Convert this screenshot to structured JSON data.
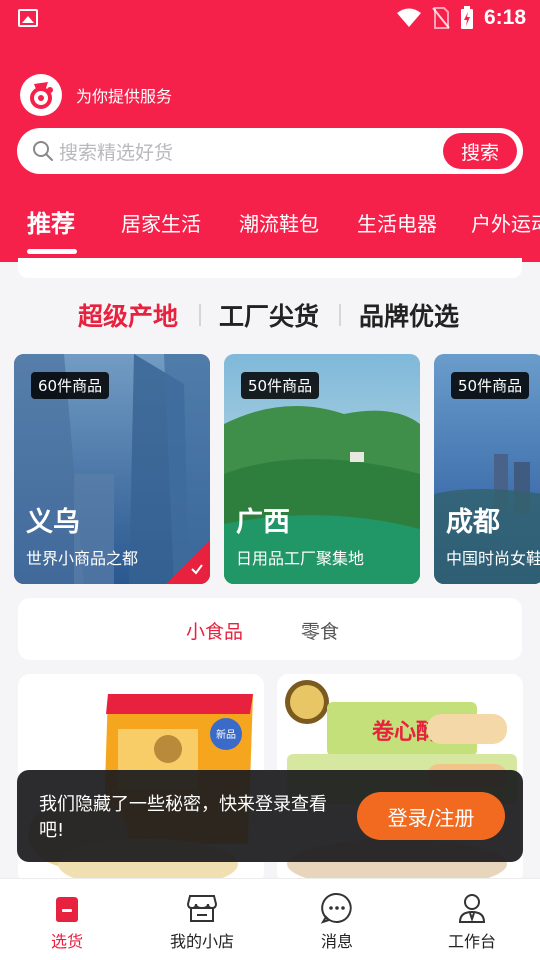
{
  "status_bar": {
    "time": "6:18"
  },
  "brand": {
    "tagline": "为你提供服务"
  },
  "search": {
    "placeholder": "搜索精选好货",
    "button_label": "搜索"
  },
  "category_tabs": [
    "推荐",
    "居家生活",
    "潮流鞋包",
    "生活电器",
    "户外运动"
  ],
  "active_category": "推荐",
  "section_tabs": [
    "超级产地",
    "工厂尖货",
    "品牌优选"
  ],
  "active_section": "超级产地",
  "regions": [
    {
      "count": "60件商品",
      "name": "义乌",
      "desc": "世界小商品之都",
      "selected": true
    },
    {
      "count": "50件商品",
      "name": "广西",
      "desc": "日用品工厂聚集地",
      "selected": false
    },
    {
      "count": "50件商品",
      "name": "成都",
      "desc": "中国时尚女鞋",
      "selected": false
    }
  ],
  "sub_tabs": [
    "小食品",
    "零食"
  ],
  "active_sub_tab": "小食品",
  "products": [
    {
      "package_text": "新品",
      "image": "rice-crackers-bag"
    },
    {
      "package_text": "卷心酥",
      "image": "egg-roll-bag"
    }
  ],
  "toast": {
    "message": "我们隐藏了一些秘密，快来登录查看吧!",
    "button_label": "登录/注册"
  },
  "bottom_nav": [
    {
      "label": "选货",
      "icon": "shop-bag-icon",
      "active": true
    },
    {
      "label": "我的小店",
      "icon": "store-icon",
      "active": false
    },
    {
      "label": "消息",
      "icon": "message-icon",
      "active": false
    },
    {
      "label": "工作台",
      "icon": "workbench-icon",
      "active": false
    }
  ],
  "colors": {
    "brand_red": "#f5214a",
    "accent_red": "#e8213f",
    "login_orange": "#f26a1f"
  }
}
